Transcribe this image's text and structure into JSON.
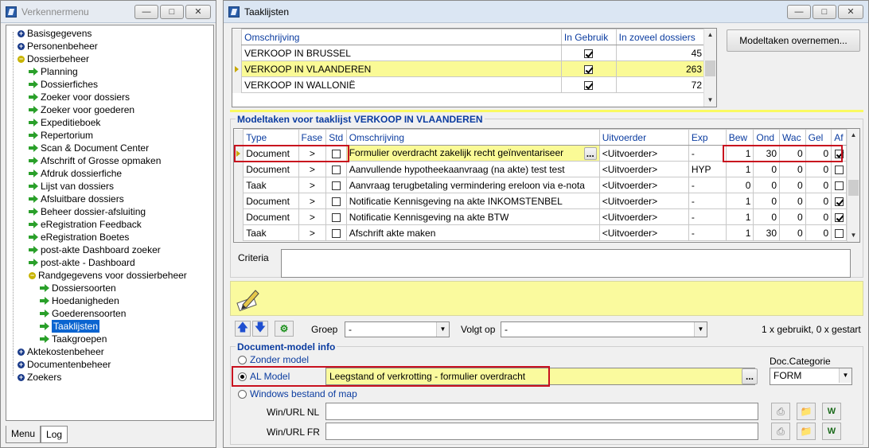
{
  "left_window": {
    "title": "Verkennermenu",
    "tree": [
      {
        "label": "Basisgegevens",
        "type": "expand",
        "level": 0,
        "open": false
      },
      {
        "label": "Personenbeheer",
        "type": "expand",
        "level": 0,
        "open": false
      },
      {
        "label": "Dossierbeheer",
        "type": "expand",
        "level": 0,
        "open": true
      },
      {
        "label": "Planning",
        "type": "leaf",
        "level": 1
      },
      {
        "label": "Dossierfiches",
        "type": "leaf",
        "level": 1
      },
      {
        "label": "Zoeker voor dossiers",
        "type": "leaf",
        "level": 1
      },
      {
        "label": "Zoeker voor goederen",
        "type": "leaf",
        "level": 1
      },
      {
        "label": "Expeditieboek",
        "type": "leaf",
        "level": 1
      },
      {
        "label": "Repertorium",
        "type": "leaf",
        "level": 1
      },
      {
        "label": "Scan & Document Center",
        "type": "leaf",
        "level": 1
      },
      {
        "label": "Afschrift of Grosse opmaken",
        "type": "leaf",
        "level": 1
      },
      {
        "label": "Afdruk dossierfiche",
        "type": "leaf",
        "level": 1
      },
      {
        "label": "Lijst van dossiers",
        "type": "leaf",
        "level": 1
      },
      {
        "label": "Afsluitbare dossiers",
        "type": "leaf",
        "level": 1
      },
      {
        "label": "Beheer dossier-afsluiting",
        "type": "leaf",
        "level": 1
      },
      {
        "label": "eRegistration Feedback",
        "type": "leaf",
        "level": 1
      },
      {
        "label": "eRegistration Boetes",
        "type": "leaf",
        "level": 1
      },
      {
        "label": "post-akte Dashboard zoeker",
        "type": "leaf",
        "level": 1
      },
      {
        "label": "post-akte - Dashboard",
        "type": "leaf",
        "level": 1
      },
      {
        "label": "Randgegevens voor dossierbeheer",
        "type": "expand",
        "level": 1,
        "open": true
      },
      {
        "label": "Dossiersoorten",
        "type": "leaf",
        "level": 2
      },
      {
        "label": "Hoedanigheden",
        "type": "leaf",
        "level": 2
      },
      {
        "label": "Goederensoorten",
        "type": "leaf",
        "level": 2
      },
      {
        "label": "Taaklijsten",
        "type": "leaf",
        "level": 2,
        "selected": true
      },
      {
        "label": "Taakgroepen",
        "type": "leaf",
        "level": 2
      },
      {
        "label": "Aktekostenbeheer",
        "type": "expand",
        "level": 0,
        "open": false
      },
      {
        "label": "Documentenbeheer",
        "type": "expand",
        "level": 0,
        "open": false
      },
      {
        "label": "Zoekers",
        "type": "expand",
        "level": 0,
        "open": false
      }
    ],
    "tabs": [
      "Menu",
      "Log"
    ]
  },
  "right_window": {
    "title": "Taaklijsten",
    "lists": {
      "headers": [
        "Omschrijving",
        "In Gebruik",
        "In zoveel dossiers"
      ],
      "rows": [
        {
          "omschrijving": "VERKOOP IN BRUSSEL",
          "in_gebruik": true,
          "dossiers": "45"
        },
        {
          "omschrijving": "VERKOOP IN VLAANDEREN",
          "in_gebruik": true,
          "dossiers": "263",
          "selected": true
        },
        {
          "omschrijving": "VERKOOP IN WALLONIË",
          "in_gebruik": true,
          "dossiers": "72"
        }
      ]
    },
    "overnemen_button": "Modeltaken overnemen...",
    "tasks_group_label": "Modeltaken voor taaklijst VERKOOP IN VLAANDEREN",
    "tasks": {
      "headers": [
        "Type",
        "Fase",
        "Std",
        "Omschrijving",
        "Uitvoerder",
        "Exp",
        "Bew",
        "Ond",
        "Wac",
        "Gel",
        "Af"
      ],
      "rows": [
        {
          "type": "Document",
          "fase": ">",
          "std": false,
          "omschrijving": "Formulier overdracht zakelijk recht geïnventariseer",
          "uitvoerder": "<Uitvoerder>",
          "exp": "-",
          "bew": "1",
          "ond": "30",
          "wac": "0",
          "gel": "0",
          "af": true,
          "selected": true
        },
        {
          "type": "Document",
          "fase": ">",
          "std": false,
          "omschrijving": "Aanvullende hypotheekaanvraag (na akte) test test",
          "uitvoerder": "<Uitvoerder>",
          "exp": "HYP",
          "bew": "1",
          "ond": "0",
          "wac": "0",
          "gel": "0",
          "af": false
        },
        {
          "type": "Taak",
          "fase": ">",
          "std": false,
          "omschrijving": "Aanvraag terugbetaling vermindering ereloon via e-nota",
          "uitvoerder": "<Uitvoerder>",
          "exp": "-",
          "bew": "0",
          "ond": "0",
          "wac": "0",
          "gel": "0",
          "af": false
        },
        {
          "type": "Document",
          "fase": ">",
          "std": false,
          "omschrijving": "Notificatie Kennisgeving na akte INKOMSTENBEL",
          "uitvoerder": "<Uitvoerder>",
          "exp": "-",
          "bew": "1",
          "ond": "0",
          "wac": "0",
          "gel": "0",
          "af": true
        },
        {
          "type": "Document",
          "fase": ">",
          "std": false,
          "omschrijving": "Notificatie Kennisgeving na akte BTW",
          "uitvoerder": "<Uitvoerder>",
          "exp": "-",
          "bew": "1",
          "ond": "0",
          "wac": "0",
          "gel": "0",
          "af": true
        },
        {
          "type": "Taak",
          "fase": ">",
          "std": false,
          "omschrijving": "Afschrift akte maken",
          "uitvoerder": "<Uitvoerder>",
          "exp": "-",
          "bew": "1",
          "ond": "30",
          "wac": "0",
          "gel": "0",
          "af": false
        }
      ]
    },
    "criteria_label": "Criteria",
    "criteria_value": "",
    "groep_label": "Groep",
    "groep_value": "-",
    "volgt_op_label": "Volgt op",
    "volgt_op_value": "-",
    "usage_text": "1 x gebruikt, 0 x gestart",
    "doc_model_group_label": "Document-model info",
    "radio_zonder": "Zonder model",
    "radio_al": "AL Model",
    "radio_windows": "Windows bestand of map",
    "al_model_value": "Leegstand of verkrotting - formulier overdracht",
    "doc_categorie_label": "Doc.Categorie",
    "doc_categorie_value": "FORM",
    "win_url_nl_label": "Win/URL NL",
    "win_url_fr_label": "Win/URL FR",
    "win_url_nl_value": "",
    "win_url_fr_value": "",
    "ellipsis": "..."
  }
}
